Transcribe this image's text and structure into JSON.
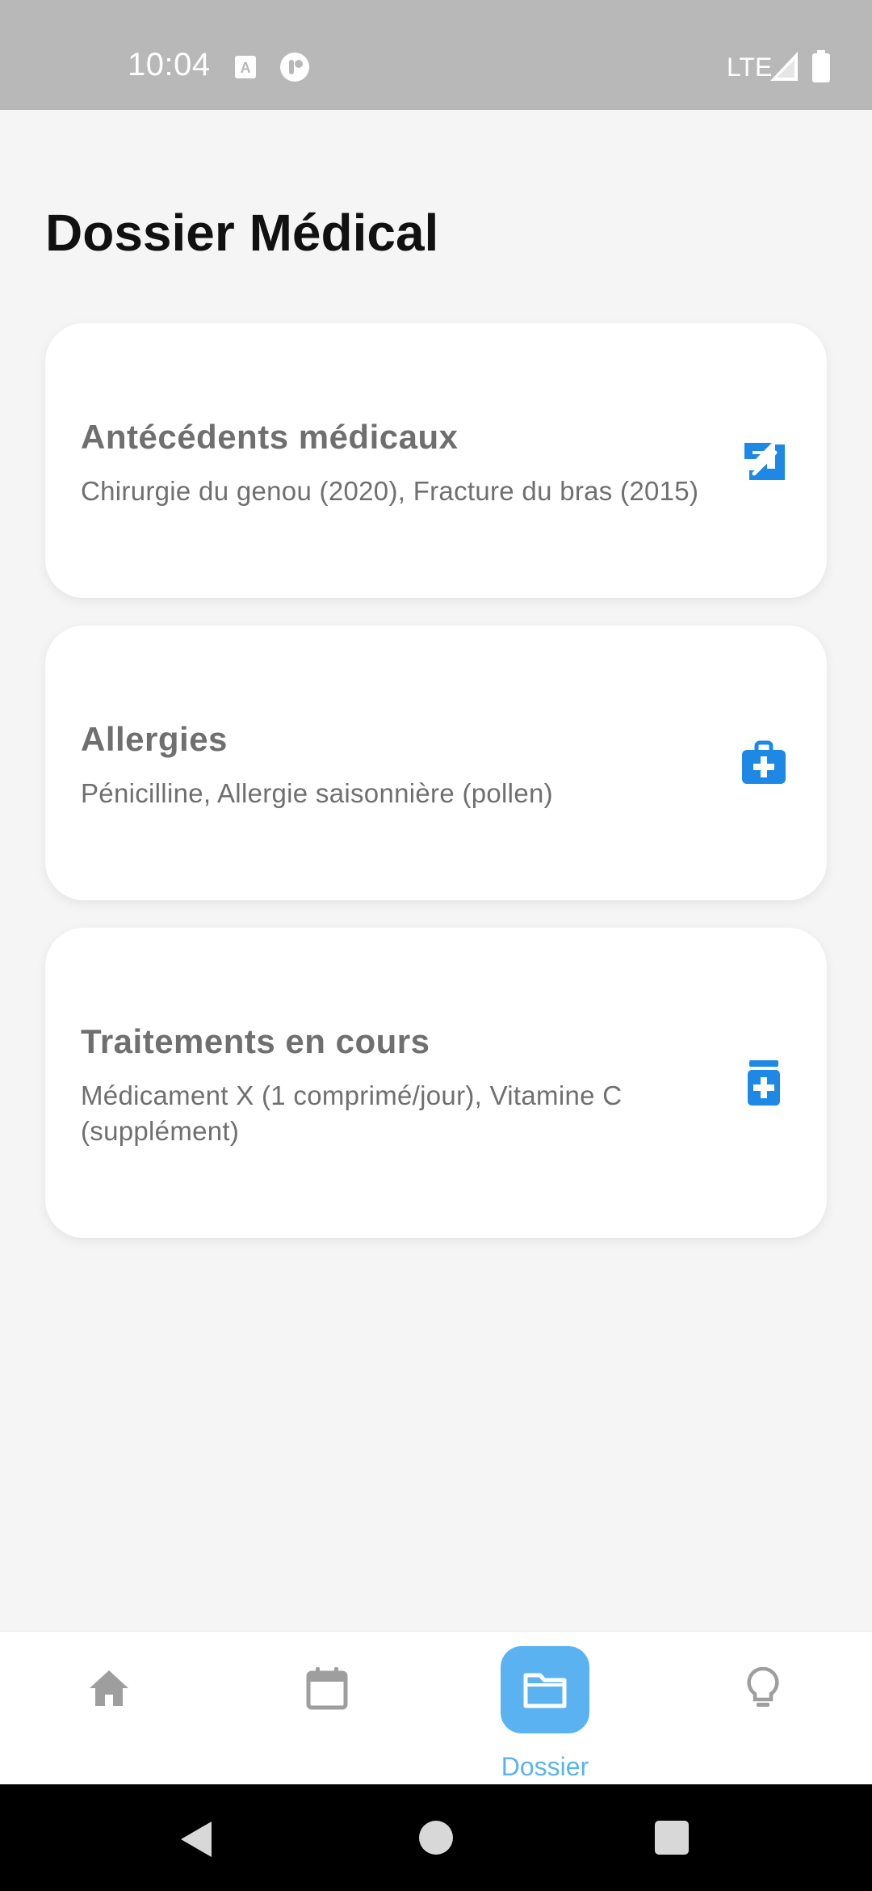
{
  "status_bar": {
    "time": "10:04",
    "network": "LTE"
  },
  "page": {
    "title": "Dossier Médical"
  },
  "cards": [
    {
      "title": "Antécédents médicaux",
      "text": "Chirurgie du genou (2020), Fracture du bras (2015)",
      "icon": "broken-arm-icon"
    },
    {
      "title": "Allergies",
      "text": "Pénicilline, Allergie saisonnière (pollen)",
      "icon": "medical-bag-icon"
    },
    {
      "title": "Traitements en cours",
      "text": "Médicament X (1 comprimé/jour), Vitamine C (supplément)",
      "icon": "pill-bottle-icon"
    }
  ],
  "bottom_nav": {
    "items": [
      {
        "icon": "home-icon",
        "label": ""
      },
      {
        "icon": "calendar-icon",
        "label": ""
      },
      {
        "icon": "folder-icon",
        "label": "Dossier",
        "active": true
      },
      {
        "icon": "lightbulb-icon",
        "label": ""
      }
    ]
  },
  "colors": {
    "accent": "#5ab3f0",
    "icon_blue": "#1e88e5",
    "nav_inactive": "#9e9e9e",
    "text_muted": "#6f6f6f",
    "background": "#f5f5f5"
  }
}
